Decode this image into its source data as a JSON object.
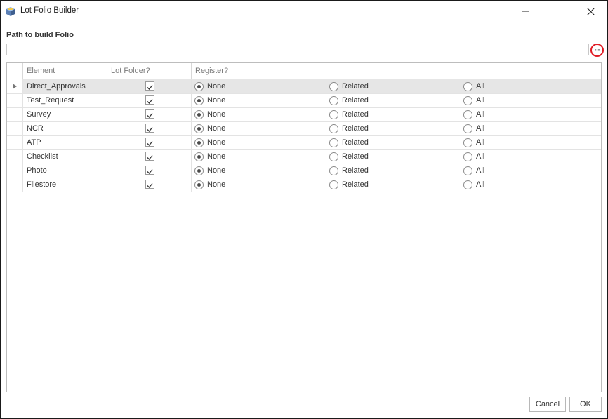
{
  "window": {
    "title": "Lot Folio Builder",
    "minimize_label": "—",
    "maximize_label": "☐",
    "close_label": "✕"
  },
  "path": {
    "label": "Path to build Folio",
    "value": "",
    "placeholder": "",
    "browse_label": "···",
    "browse_highlight_color": "#e01b24"
  },
  "grid": {
    "columns": [
      "Element",
      "Lot Folder?",
      "Register?"
    ],
    "register_options": [
      "None",
      "Related",
      "All"
    ],
    "selected_row_index": 0,
    "rows": [
      {
        "element": "Direct_Approvals",
        "lot_folder": true,
        "register": "None"
      },
      {
        "element": "Test_Request",
        "lot_folder": true,
        "register": "None"
      },
      {
        "element": "Survey",
        "lot_folder": true,
        "register": "None"
      },
      {
        "element": "NCR",
        "lot_folder": true,
        "register": "None"
      },
      {
        "element": "ATP",
        "lot_folder": true,
        "register": "None"
      },
      {
        "element": "Checklist",
        "lot_folder": true,
        "register": "None"
      },
      {
        "element": "Photo",
        "lot_folder": true,
        "register": "None"
      },
      {
        "element": "Filestore",
        "lot_folder": true,
        "register": "None"
      }
    ]
  },
  "footer": {
    "cancel_label": "Cancel",
    "ok_label": "OK"
  }
}
